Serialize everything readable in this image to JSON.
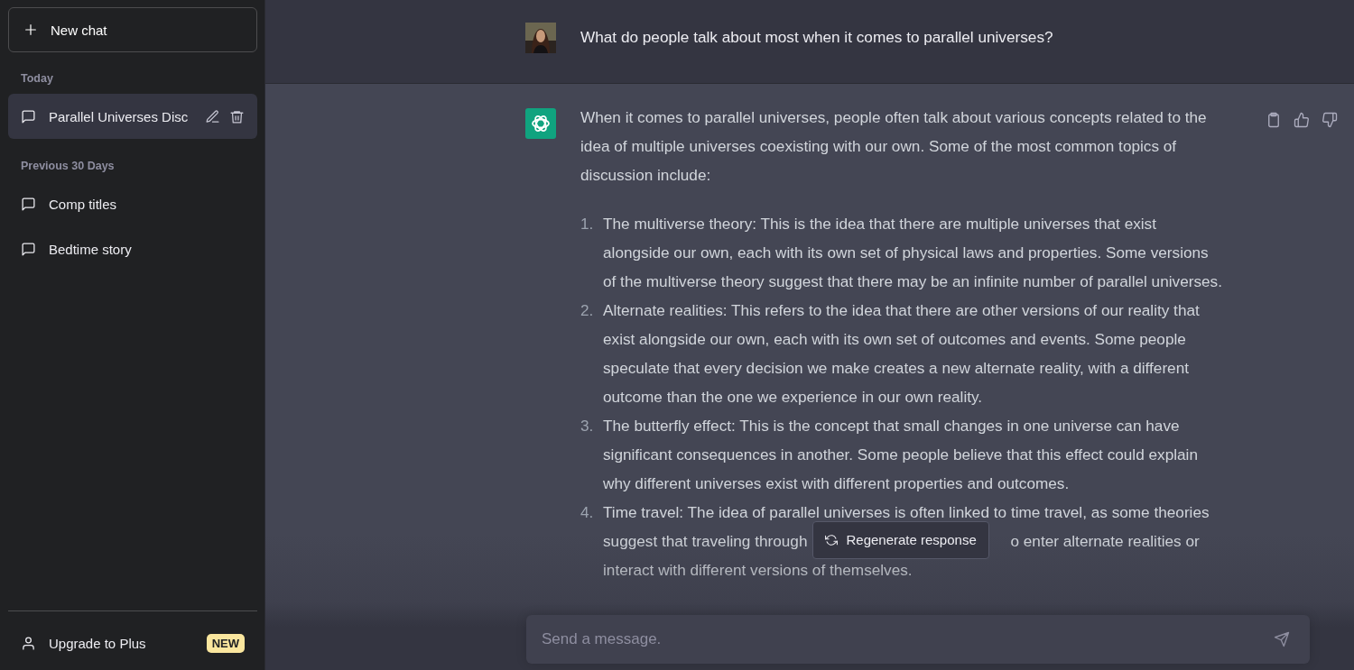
{
  "sidebar": {
    "new_chat": "New chat",
    "groups": [
      {
        "heading": "Today",
        "items": [
          {
            "title": "Parallel Universes Disc",
            "selected": true
          }
        ]
      },
      {
        "heading": "Previous 30 Days",
        "items": [
          {
            "title": "Comp titles",
            "selected": false
          },
          {
            "title": "Bedtime story",
            "selected": false
          }
        ]
      }
    ],
    "upgrade": {
      "label": "Upgrade to Plus",
      "badge": "NEW"
    }
  },
  "thread": {
    "messages": [
      {
        "kind": "user",
        "text": "What do people talk about most when it comes to parallel universes?"
      },
      {
        "kind": "assistant",
        "intro": "When it comes to parallel universes, people often talk about various concepts related to the idea of multiple universes coexisting with our own. Some of the most common topics of discussion include:",
        "list": [
          {
            "marker": "1.",
            "text": "The multiverse theory: This is the idea that there are multiple universes that exist alongside our own, each with its own set of physical laws and properties. Some versions of the multiverse theory suggest that there may be an infinite number of parallel universes."
          },
          {
            "marker": "2.",
            "text": "Alternate realities: This refers to the idea that there are other versions of our reality that exist alongside our own, each with its own set of outcomes and events. Some people speculate that every decision we make creates a new alternate reality, with a different outcome than the one we experience in our own reality."
          },
          {
            "marker": "3.",
            "text": "The butterfly effect: This is the concept that small changes in one universe can have significant consequences in another. Some people believe that this effect could explain why different universes exist with different properties and outcomes."
          },
          {
            "marker": "4.",
            "lines": [
              [
                "Time travel: The idea of parallel universes is often linked to time travel, as some theories"
              ],
              [
                "suggest that traveling through",
                "o enter alternate realities or"
              ],
              [
                "interact with different versions of themselves."
              ]
            ]
          }
        ]
      }
    ],
    "regenerate": "Regenerate response",
    "composer": {
      "placeholder": "Send a message."
    }
  }
}
